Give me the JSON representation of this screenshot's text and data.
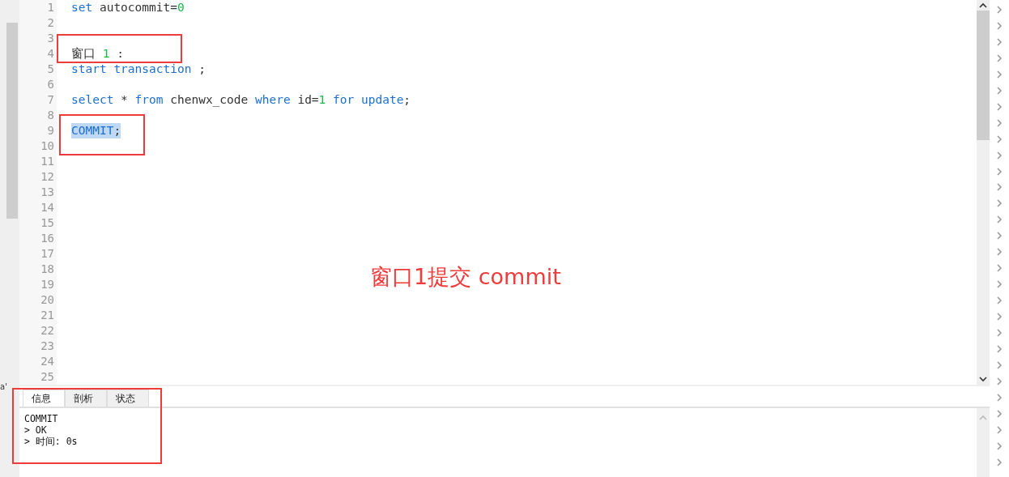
{
  "editor": {
    "lines": [
      {
        "number": "1",
        "tokens": [
          {
            "text": "set",
            "kind": "keyword",
            "selected": false
          },
          {
            "text": " autocommit=",
            "kind": "plain",
            "selected": false
          },
          {
            "text": "0",
            "kind": "number",
            "selected": false
          }
        ]
      },
      {
        "number": "2"
      },
      {
        "number": "3"
      },
      {
        "number": "4",
        "tokens": [
          {
            "text": "窗口 ",
            "kind": "plain",
            "selected": false
          },
          {
            "text": "1",
            "kind": "number",
            "selected": false
          },
          {
            "text": " :",
            "kind": "plain",
            "selected": false
          }
        ]
      },
      {
        "number": "5",
        "tokens": [
          {
            "text": "start transaction",
            "kind": "keyword",
            "selected": false
          },
          {
            "text": " ;",
            "kind": "plain",
            "selected": false
          }
        ]
      },
      {
        "number": "6"
      },
      {
        "number": "7",
        "tokens": [
          {
            "text": "select",
            "kind": "keyword",
            "selected": false
          },
          {
            "text": " * ",
            "kind": "plain",
            "selected": false
          },
          {
            "text": "from",
            "kind": "keyword",
            "selected": false
          },
          {
            "text": " chenwx_code ",
            "kind": "plain",
            "selected": false
          },
          {
            "text": "where",
            "kind": "keyword",
            "selected": false
          },
          {
            "text": " id=",
            "kind": "plain",
            "selected": false
          },
          {
            "text": "1",
            "kind": "number",
            "selected": false
          },
          {
            "text": " for",
            "kind": "keyword",
            "selected": false
          },
          {
            "text": " update",
            "kind": "keyword",
            "selected": false
          },
          {
            "text": ";",
            "kind": "plain",
            "selected": false
          }
        ]
      },
      {
        "number": "8"
      },
      {
        "number": "9",
        "tokens": [
          {
            "text": "COMMIT",
            "kind": "keyword",
            "selected": true
          },
          {
            "text": ";",
            "kind": "plain",
            "selected": true
          }
        ]
      },
      {
        "number": "10"
      },
      {
        "number": "11"
      },
      {
        "number": "12"
      },
      {
        "number": "13"
      },
      {
        "number": "14"
      },
      {
        "number": "15"
      },
      {
        "number": "16"
      },
      {
        "number": "17"
      },
      {
        "number": "18"
      },
      {
        "number": "19"
      },
      {
        "number": "20"
      },
      {
        "number": "21"
      },
      {
        "number": "22"
      },
      {
        "number": "23"
      },
      {
        "number": "24"
      },
      {
        "number": "25"
      }
    ]
  },
  "stray_text": "a'",
  "result_panel": {
    "tabs": [
      {
        "label": "信息",
        "selected": true
      },
      {
        "label": "剖析",
        "selected": false
      },
      {
        "label": "状态",
        "selected": false
      }
    ],
    "messages": [
      "COMMIT",
      "> OK",
      "> 时间: 0s"
    ]
  },
  "annotations": [
    {
      "kind": "box"
    },
    {
      "kind": "box"
    },
    {
      "kind": "box"
    },
    {
      "kind": "text",
      "text": "窗口1提交 commit"
    }
  ]
}
